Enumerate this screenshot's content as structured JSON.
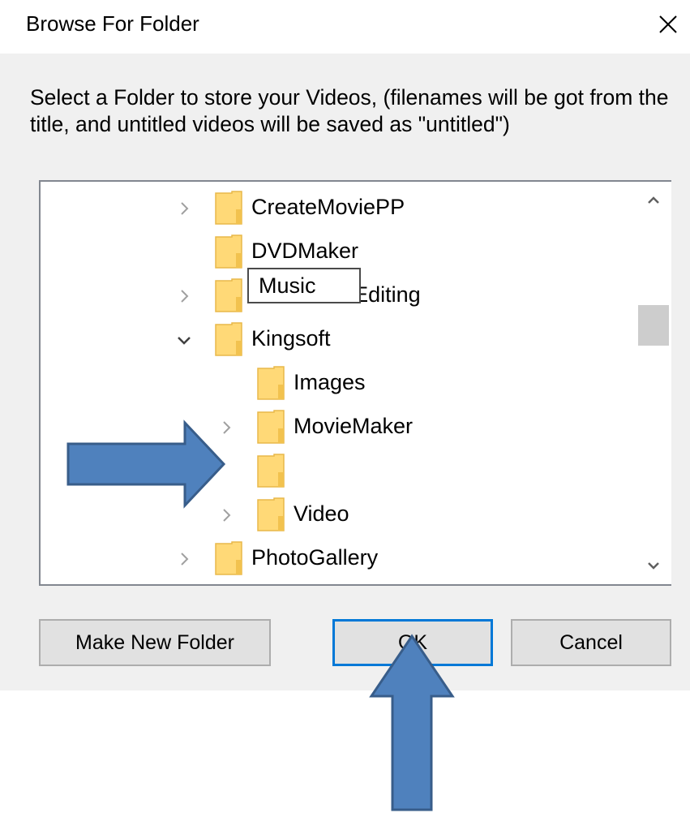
{
  "dialog": {
    "title": "Browse For Folder",
    "instruction": "Select a Folder to store your Videos, (filenames will be got from the title, and untitled videos will be saved as \"untitled\")"
  },
  "tree": {
    "nodes": [
      {
        "label": "CreateMoviePP",
        "expander": "collapsed"
      },
      {
        "label": "DVDMaker",
        "expander": "none"
      },
      {
        "label": "FreePhotoEditing",
        "expander": "collapsed"
      },
      {
        "label": "Kingsoft",
        "expander": "expanded"
      },
      {
        "label": "Images",
        "expander": "none"
      },
      {
        "label": "MovieMaker",
        "expander": "collapsed"
      },
      {
        "label": "Music",
        "expander": "none",
        "selected": true,
        "renaming": true
      },
      {
        "label": "Video",
        "expander": "collapsed"
      },
      {
        "label": "PhotoGallery",
        "expander": "collapsed"
      }
    ],
    "rename_value": "Music"
  },
  "buttons": {
    "make_new_folder": "Make New Folder",
    "ok": "OK",
    "cancel": "Cancel"
  },
  "colors": {
    "client_bg": "#f0f0f0",
    "selection": "#cce8ff",
    "folder_fill": "#ffd977",
    "focus_border": "#0078d7",
    "annotation_arrow": "#4f81bd",
    "annotation_arrow_border": "#385d8a"
  },
  "icons": {
    "close": "close-icon",
    "folder": "folder-icon",
    "collapsed": "chevron-right-icon",
    "expanded": "chevron-down-icon",
    "scroll_up": "scroll-up-icon",
    "scroll_down": "scroll-down-icon",
    "annotation_right": "arrow-right-annotation",
    "annotation_up": "arrow-up-annotation"
  }
}
